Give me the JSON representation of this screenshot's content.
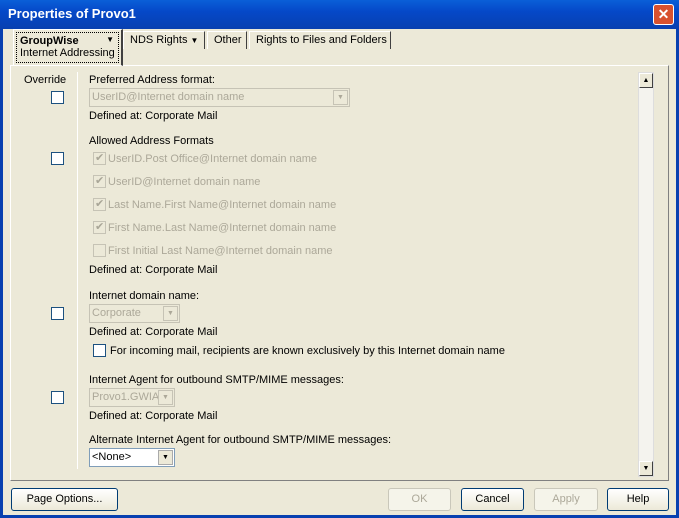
{
  "window": {
    "title": "Properties of Provo1",
    "close": "✕"
  },
  "tabs": [
    {
      "label": "GroupWise",
      "sub": "Internet Addressing"
    },
    {
      "label": "NDS Rights"
    },
    {
      "label": "Other"
    },
    {
      "label": "Rights to Files and Folders"
    }
  ],
  "override_label": "Override",
  "preferred": {
    "label": "Preferred Address format:",
    "value": "UserID@Internet domain name",
    "defined": "Defined at:  Corporate Mail"
  },
  "allowed": {
    "label": "Allowed Address Formats",
    "items": [
      {
        "label": "UserID.Post Office@Internet domain name",
        "checked": true
      },
      {
        "label": "UserID@Internet domain name",
        "checked": true
      },
      {
        "label": "Last Name.First Name@Internet domain name",
        "checked": true
      },
      {
        "label": "First Name.Last Name@Internet domain name",
        "checked": true
      },
      {
        "label": "First Initial Last Name@Internet domain name",
        "checked": false
      }
    ],
    "defined": "Defined at:  Corporate Mail"
  },
  "domain": {
    "label": "Internet domain name:",
    "value": "Corporate",
    "defined": "Defined at:  Corporate Mail",
    "exclusive_label": "For incoming mail, recipients are known exclusively by this Internet domain name"
  },
  "agent": {
    "label": "Internet Agent for outbound SMTP/MIME messages:",
    "value": "Provo1.GWIA",
    "defined": "Defined at:  Corporate Mail"
  },
  "alt_agent": {
    "label": "Alternate Internet Agent for outbound SMTP/MIME messages:",
    "value": "<None>"
  },
  "buttons": {
    "page_options": "Page Options...",
    "ok": "OK",
    "cancel": "Cancel",
    "apply": "Apply",
    "help": "Help"
  }
}
